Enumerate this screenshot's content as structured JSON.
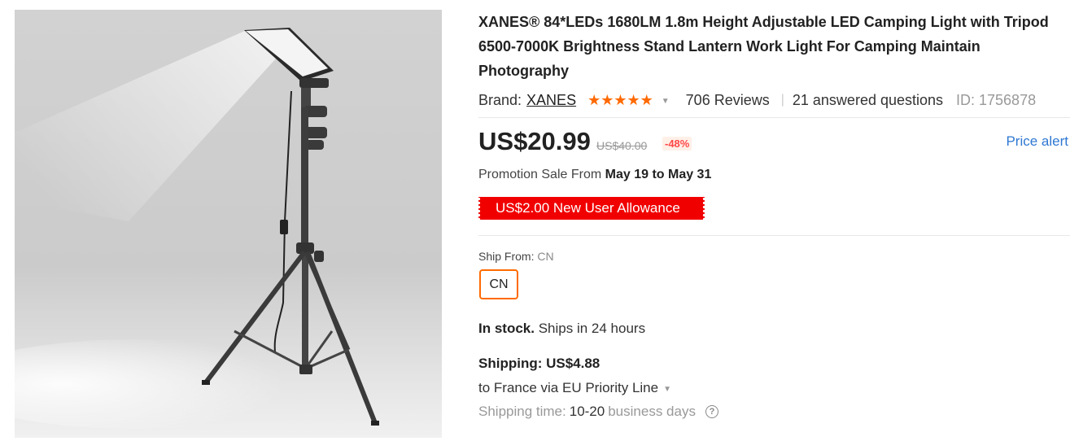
{
  "product": {
    "title": "XANES® 84*LEDs 1680LM 1.8m Height Adjustable LED Camping Light with Tripod 6500-7000K Brightness Stand Lantern Work Light For Camping Maintain Photography",
    "image_alt": "LED camping light on tripod stand",
    "brand_label": "Brand:",
    "brand_name": "XANES",
    "stars": "★★★★★",
    "rating_icon": "star-icon",
    "reviews": "706 Reviews",
    "questions": "21 answered questions",
    "product_id": "ID: 1756878"
  },
  "price": {
    "current": "US$20.99",
    "original": "US$40.00",
    "discount": "-48%",
    "alert_label": "Price alert"
  },
  "promotion": {
    "label": "Promotion Sale From",
    "dates": "May 19 to May 31",
    "allowance": "US$2.00 New User Allowance"
  },
  "shipping": {
    "from_label": "Ship From:",
    "from_value": "CN",
    "option": "CN",
    "stock_bold": "In stock.",
    "stock_rest": "Ships in 24 hours",
    "cost": "Shipping: US$4.88",
    "destination": "to France via EU Priority Line",
    "time_label": "Shipping time:",
    "time_value": "10-20",
    "time_unit": "business days"
  },
  "colors": {
    "accent": "#ff6a00",
    "link": "#2e78d2",
    "allowance_bg": "#f10000",
    "discount": "#ff4747"
  }
}
